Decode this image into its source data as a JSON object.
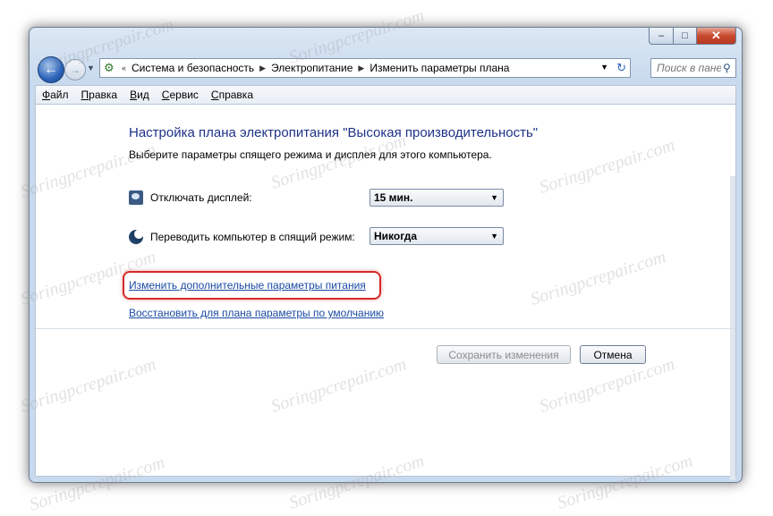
{
  "window": {
    "caption_buttons": {
      "minimize": "–",
      "maximize": "□",
      "close": "✕"
    }
  },
  "navigation": {
    "back_glyph": "←",
    "forward_glyph": "→",
    "dropdown_glyph": "▼",
    "breadcrumb": [
      "Система и безопасность",
      "Электропитание",
      "Изменить параметры плана"
    ],
    "breadcrumb_prefix": "«",
    "separator": "▶",
    "refresh_glyph": "↻",
    "search_placeholder": "Поиск в панели",
    "search_glyph": "⚲"
  },
  "menu": [
    "Файл",
    "Правка",
    "Вид",
    "Сервис",
    "Справка"
  ],
  "content": {
    "title": "Настройка плана электропитания \"Высокая производительность\"",
    "subtitle": "Выберите параметры спящего режима и дисплея для этого компьютера.",
    "display_label": "Отключать дисплей:",
    "display_value": "15 мин.",
    "sleep_label": "Переводить компьютер в спящий режим:",
    "sleep_value": "Никогда",
    "select_arrow": "▼",
    "link_advanced": "Изменить дополнительные параметры питания",
    "link_restore": "Восстановить для плана параметры по умолчанию",
    "save_button": "Сохранить изменения",
    "cancel_button": "Отмена"
  },
  "watermark_text": "Soringpcrepair.com",
  "colors": {
    "title": "#1e3287",
    "link": "#1a4aa3",
    "highlight": "#d42a2a"
  }
}
